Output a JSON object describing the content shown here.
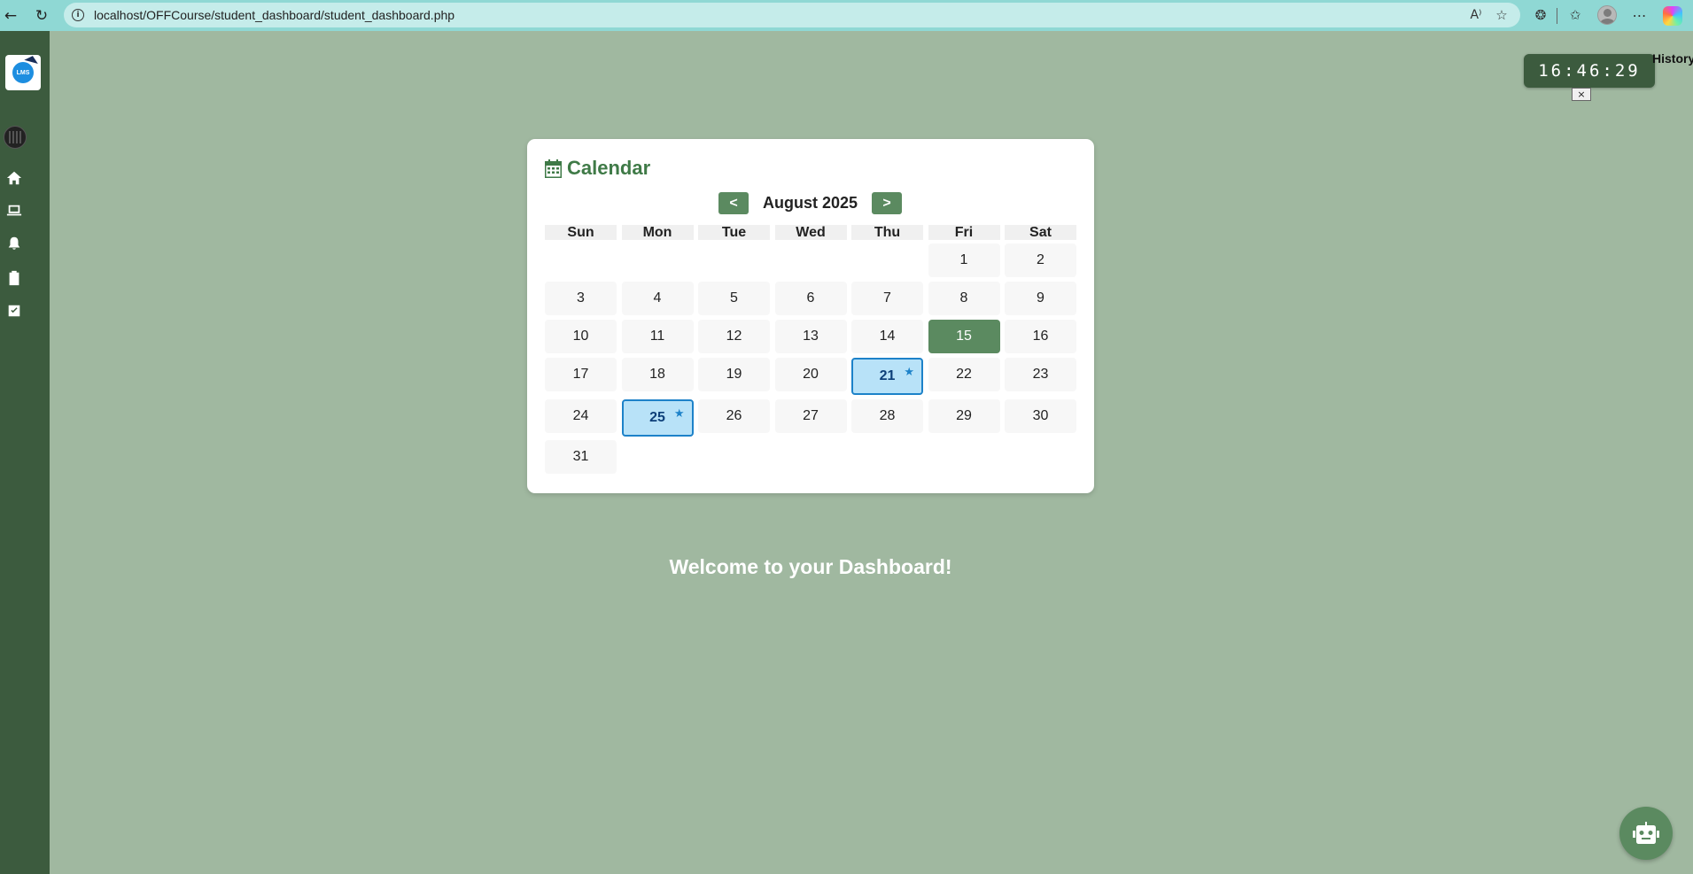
{
  "browser": {
    "url": "localhost/OFFCourse/student_dashboard/student_dashboard.php",
    "read_aloud_label": "A⁾"
  },
  "sidebar": {
    "logo_text": "LMS",
    "items": [
      {
        "name": "home",
        "icon": "home-icon"
      },
      {
        "name": "courses",
        "icon": "laptop-icon"
      },
      {
        "name": "notifications",
        "icon": "bell-icon"
      },
      {
        "name": "assignments",
        "icon": "clipboard-icon"
      },
      {
        "name": "tasks",
        "icon": "check-square-icon"
      }
    ]
  },
  "clock": {
    "time": "16:46:29",
    "close_label": "×"
  },
  "history_label": "History",
  "calendar": {
    "title": "Calendar",
    "prev_label": "<",
    "next_label": ">",
    "month_label": "August 2025",
    "weekdays": [
      "Sun",
      "Mon",
      "Tue",
      "Wed",
      "Thu",
      "Fri",
      "Sat"
    ],
    "today": 15,
    "event_days": [
      21,
      25
    ],
    "event_marker": "★",
    "days": [
      "1",
      "2",
      "3",
      "4",
      "5",
      "6",
      "7",
      "8",
      "9",
      "10",
      "11",
      "12",
      "13",
      "14",
      "15",
      "16",
      "17",
      "18",
      "19",
      "20",
      "21",
      "22",
      "23",
      "24",
      "25",
      "26",
      "27",
      "28",
      "29",
      "30",
      "31"
    ],
    "colors": {
      "accent": "#5b8a60",
      "event_bg": "#b8e2f8",
      "event_border": "#1d82c9"
    }
  },
  "welcome_text": "Welcome to your Dashboard!",
  "chatbot": {
    "icon": "robot-icon"
  }
}
